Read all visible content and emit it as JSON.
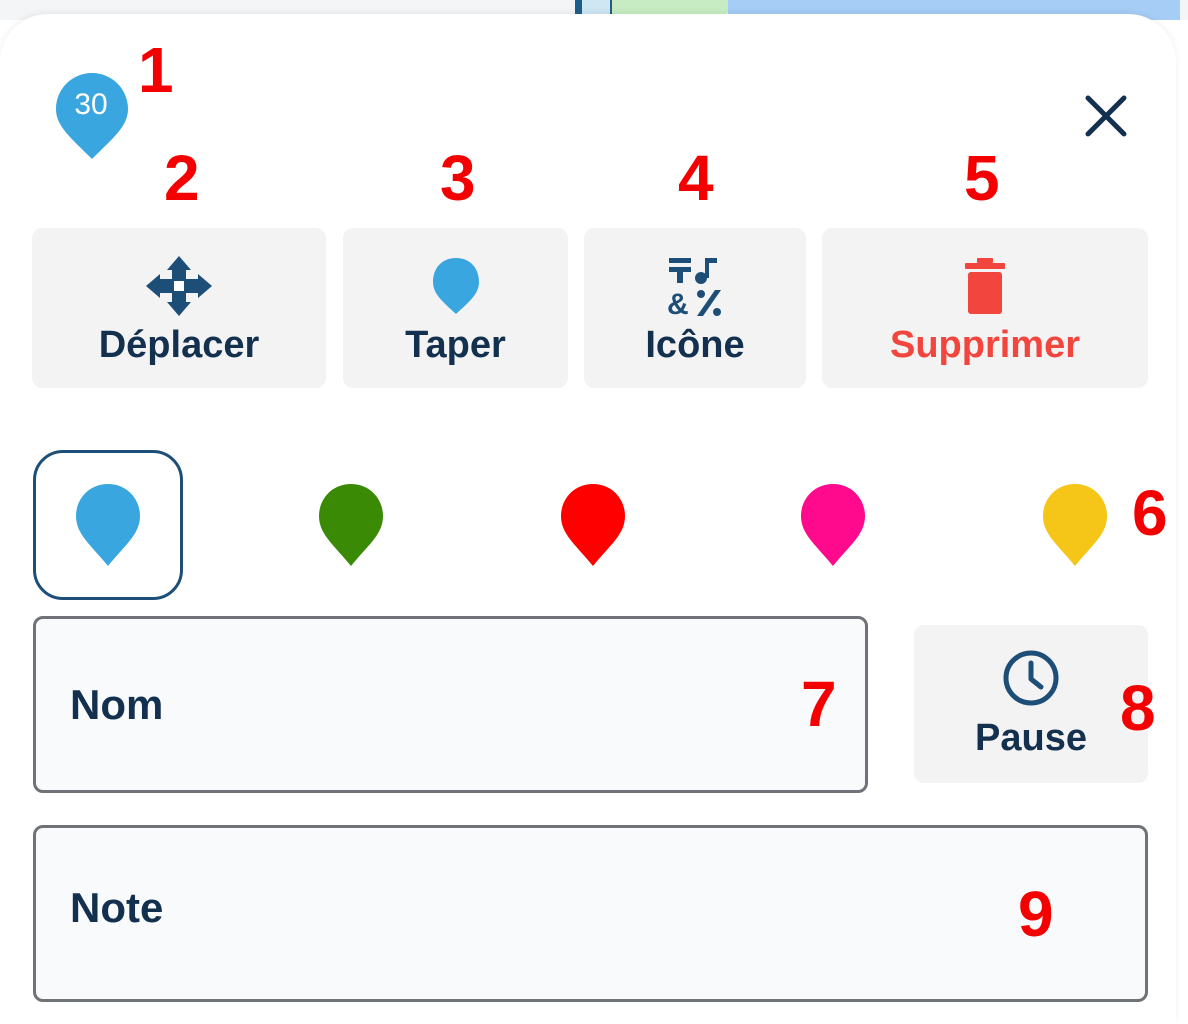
{
  "map_background": {
    "text": ""
  },
  "marker": {
    "number": "30",
    "color": "#3aa6e0",
    "icon": "map-pin-icon"
  },
  "close": {
    "icon": "close-icon"
  },
  "actions": [
    {
      "label": "Déplacer",
      "icon": "move-arrows-icon"
    },
    {
      "label": "Taper",
      "icon": "pin-type-icon"
    },
    {
      "label": "Icône",
      "icon": "symbols-icon"
    },
    {
      "label": "Supprimer",
      "icon": "trash-icon",
      "color": "#f2453d"
    }
  ],
  "colors": [
    {
      "value": "#3aa6e0",
      "selected": true
    },
    {
      "value": "#3a8a06",
      "selected": false
    },
    {
      "value": "#ff0000",
      "selected": false
    },
    {
      "value": "#ff0a8c",
      "selected": false
    },
    {
      "value": "#f5c518",
      "selected": false
    }
  ],
  "name_field": {
    "placeholder": "Nom",
    "value": ""
  },
  "note_field": {
    "placeholder": "Note",
    "value": ""
  },
  "pause": {
    "label": "Pause",
    "icon": "clock-icon"
  },
  "annotations": [
    "1",
    "2",
    "3",
    "4",
    "5",
    "6",
    "7",
    "8",
    "9"
  ],
  "theme": {
    "text": "#13304f",
    "danger": "#f2453d",
    "annotation": "#f40000",
    "button_bg": "#f3f3f3"
  }
}
